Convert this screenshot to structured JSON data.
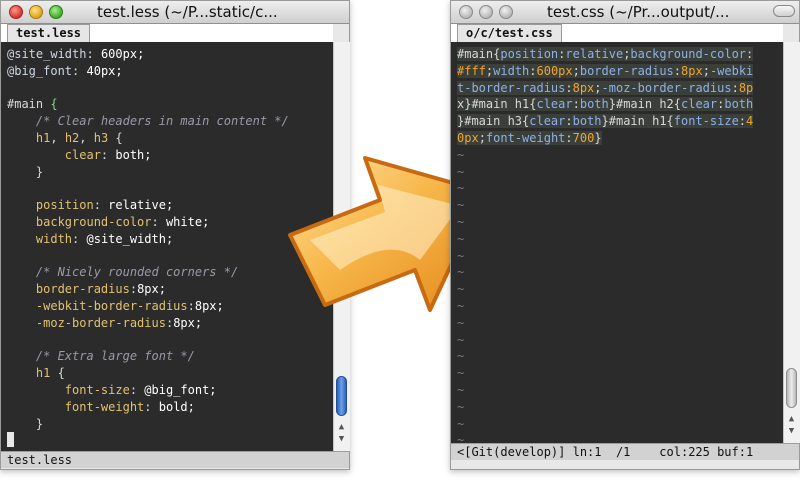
{
  "left_window": {
    "title": "test.less (~/P...static/c...",
    "tab_label": "test.less",
    "status": "test.less",
    "code_lines": [
      "@site_width: 600px;",
      "@big_font: 40px;",
      "",
      "#main {",
      "    /* Clear headers in main content */",
      "    h1, h2, h3 {",
      "        clear: both;",
      "    }",
      "",
      "    position: relative;",
      "    background-color: white;",
      "    width: @site_width;",
      "",
      "    /* Nicely rounded corners */",
      "    border-radius:8px;",
      "    -webkit-border-radius:8px;",
      "    -moz-border-radius:8px;",
      "",
      "    /* Extra large font */",
      "    h1 {",
      "        font-size: @big_font;",
      "        font-weight: bold;",
      "    }",
      "}"
    ]
  },
  "right_window": {
    "title": "test.css (~/Pr...output/...",
    "tab_label": "o/c/test.css",
    "status": "<[Git(develop)] ln:1  /1    col:225 buf:1",
    "code_lines": [
      "#main{position:relative;background-color:",
      "#fff;width:600px;border-radius:8px;-webki",
      "t-border-radius:8px;-moz-border-radius:8p",
      "x}#main h1{clear:both}#main h2{clear:both",
      "}#main h3{clear:both}#main h1{font-size:4",
      "0px;font-weight:700}"
    ],
    "tilde_count": 18,
    "tilde": "~"
  },
  "arrow": {
    "color": "#f2a93a",
    "direction": "right"
  },
  "colors": {
    "editor_bg": "#2b2b2b",
    "keyword": "#e2c270",
    "comment": "#9a9aa8",
    "value_blue": "#8fb0e8",
    "value_orange": "#f0a62c"
  }
}
